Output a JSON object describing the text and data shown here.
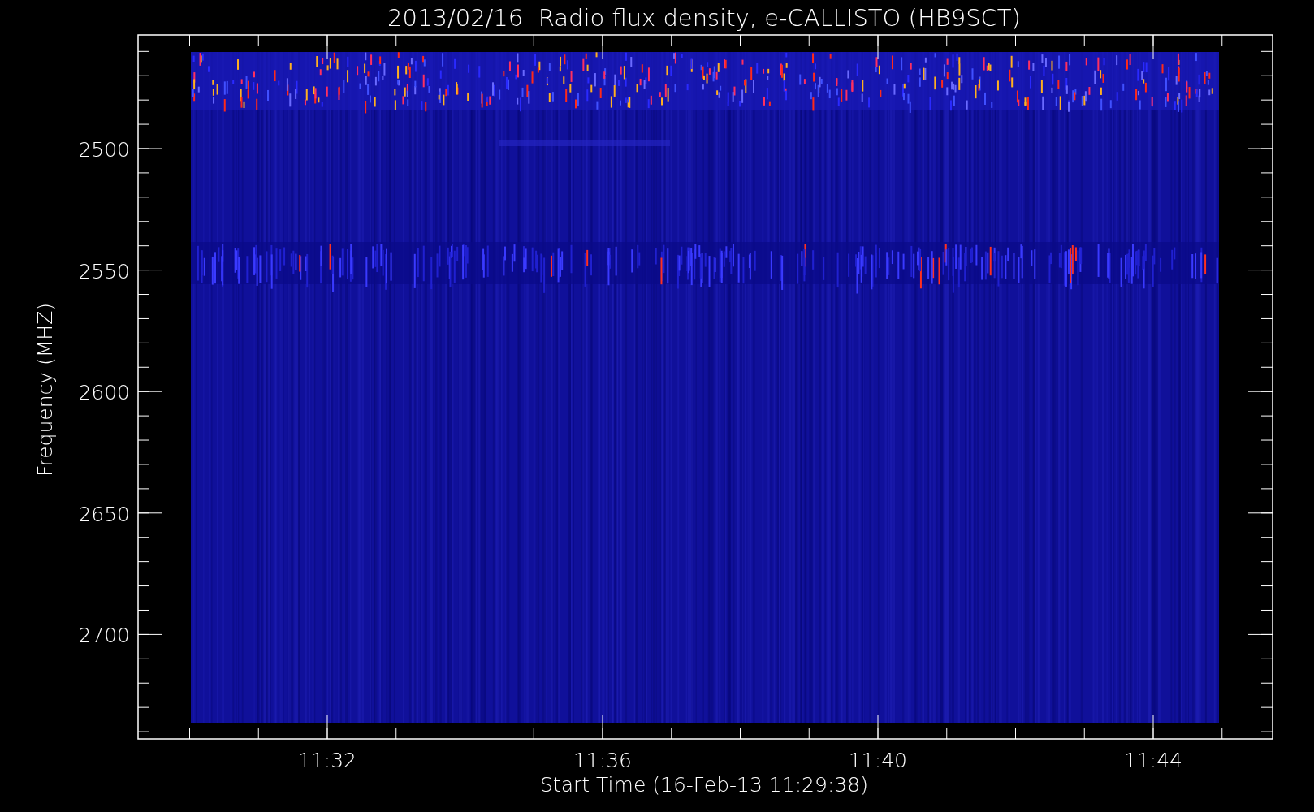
{
  "title": "2013/02/16  Radio flux density, e-CALLISTO (HB9SCT)",
  "xlabel": "Start Time (16-Feb-13 11:29:38)",
  "ylabel": "Frequency (MHZ)",
  "xticks": [
    "11:32",
    "11:36",
    "11:40",
    "11:44"
  ],
  "yticks": [
    "2500",
    "2550",
    "2600",
    "2650",
    "2700"
  ]
}
